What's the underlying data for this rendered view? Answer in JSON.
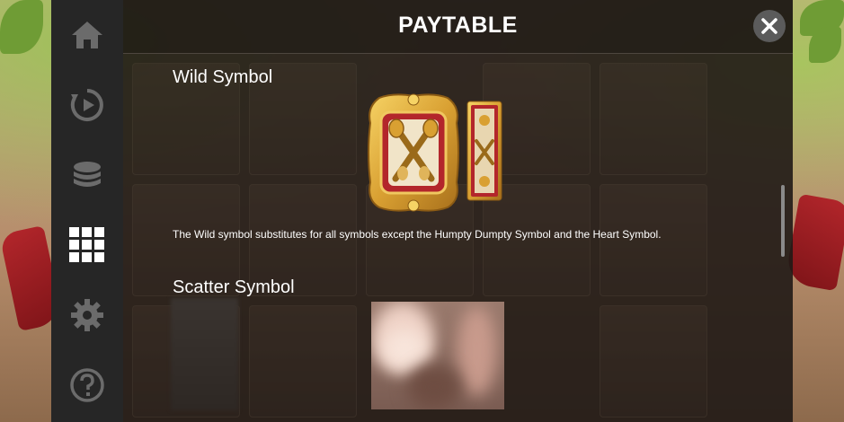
{
  "header": {
    "title": "PAYTABLE"
  },
  "sidebar": {
    "items": [
      {
        "icon": "home-icon"
      },
      {
        "icon": "replay-icon"
      },
      {
        "icon": "coins-icon"
      },
      {
        "icon": "grid-icon",
        "active": true
      },
      {
        "icon": "gear-icon"
      },
      {
        "icon": "help-icon"
      }
    ]
  },
  "sections": {
    "wild": {
      "title": "Wild Symbol",
      "description": "The Wild symbol substitutes for all symbols except the Humpty Dumpty Symbol and the Heart Symbol."
    },
    "scatter": {
      "title": "Scatter Symbol"
    }
  },
  "colors": {
    "sidebar_bg": "#262626",
    "icon_inactive": "#6b6b6b",
    "icon_active": "#ffffff",
    "gold": "#d9a032",
    "red": "#b3262b"
  }
}
